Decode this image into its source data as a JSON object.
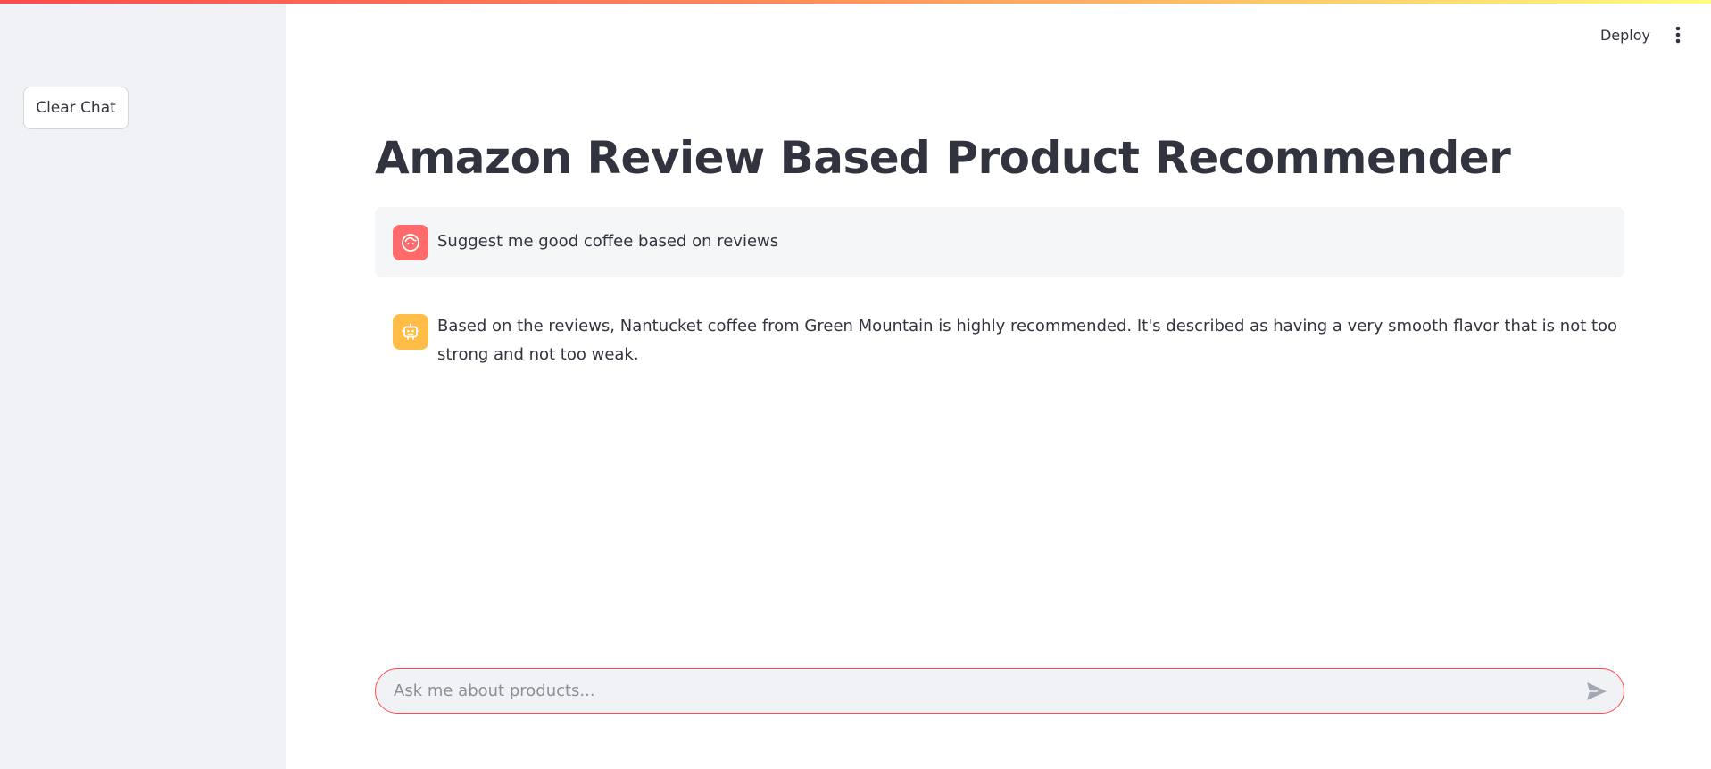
{
  "sidebar": {
    "clear_chat_label": "Clear Chat"
  },
  "header": {
    "deploy_label": "Deploy",
    "menu_icon": "vertical-dots-icon"
  },
  "main": {
    "title": "Amazon Review Based Product Recommender",
    "messages": [
      {
        "role": "user",
        "avatar_icon": "user-face-icon",
        "avatar_color": "#ff6b6b",
        "text": "Suggest me good coffee based on reviews"
      },
      {
        "role": "assistant",
        "avatar_icon": "robot-icon",
        "avatar_color": "#ffbd45",
        "text": "Based on the reviews, Nantucket coffee from Green Mountain is highly recommended. It's described as having a very smooth flavor that is not too strong and not too weak."
      }
    ]
  },
  "chat_input": {
    "placeholder": "Ask me about products...",
    "value": "",
    "send_icon": "send-icon"
  },
  "colors": {
    "accent": "#ff4b4b",
    "sidebar_bg": "#f0f2f6",
    "text": "#31333f"
  }
}
